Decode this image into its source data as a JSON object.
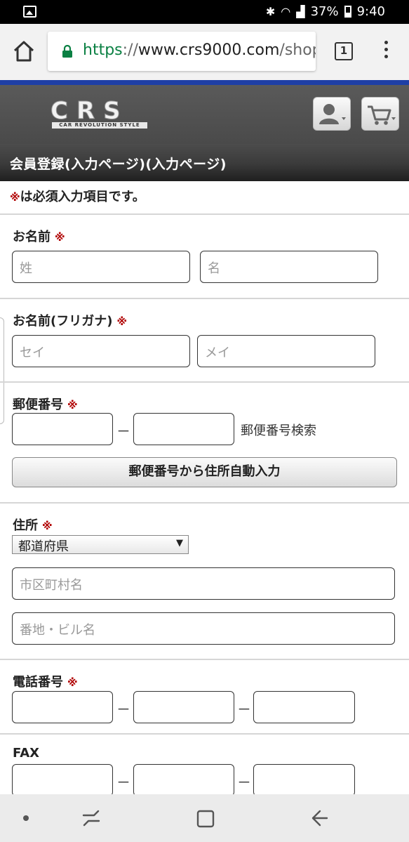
{
  "status_bar": {
    "battery": "37%",
    "time": "9:40",
    "icons": [
      "image-icon",
      "bluetooth-icon",
      "wifi-icon",
      "signal-icon",
      "battery-icon"
    ]
  },
  "browser": {
    "url_scheme": "https",
    "url_sep": "://",
    "url_host": "www.crs9000.com",
    "url_path": "/shop",
    "tab_count": "1"
  },
  "site": {
    "logo_text": "CRS",
    "logo_tagline": "CAR REVOLUTION STYLE",
    "page_title": "会員登録(入力ページ)(入力ページ)"
  },
  "form": {
    "required_mark": "※",
    "required_note": "は必須入力項目です。",
    "name": {
      "label": "お名前",
      "last_placeholder": "姓",
      "first_placeholder": "名"
    },
    "kana": {
      "label": "お名前(フリガナ)",
      "last_placeholder": "セイ",
      "first_placeholder": "メイ"
    },
    "zip": {
      "label": "郵便番号",
      "separator": "－",
      "search_link": "郵便番号検索",
      "auto_button": "郵便番号から住所自動入力"
    },
    "address": {
      "label": "住所",
      "prefecture": "都道府県",
      "city_placeholder": "市区町村名",
      "street_placeholder": "番地・ビル名"
    },
    "phone": {
      "label": "電話番号",
      "separator": "－"
    },
    "fax": {
      "label": "FAX",
      "separator": "－"
    }
  },
  "colors": {
    "brand_blue": "#1f3fa6",
    "required_red": "#b00000",
    "url_green": "#0b8043"
  }
}
